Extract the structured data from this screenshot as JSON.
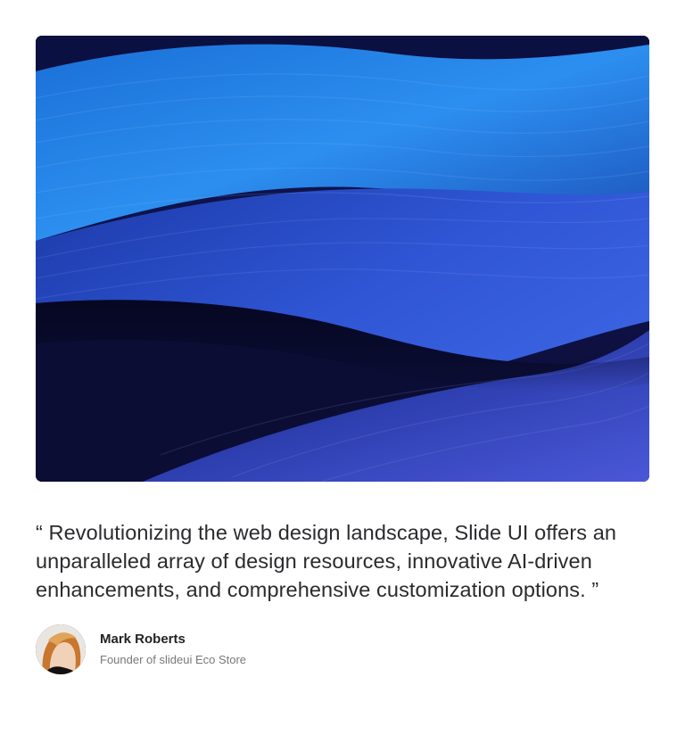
{
  "testimonial": {
    "quote": "“ Revolutionizing the web design landscape, Slide UI offers an unparalleled array of design resources, innovative AI-driven enhancements, and comprehensive customization options. ”",
    "author_name": "Mark Roberts",
    "author_role": "Founder of slideui Eco Store"
  },
  "colors": {
    "accent_blue": "#2f5ad8",
    "deep_navy": "#0b0a2a",
    "light_blue": "#1e8ae6"
  }
}
